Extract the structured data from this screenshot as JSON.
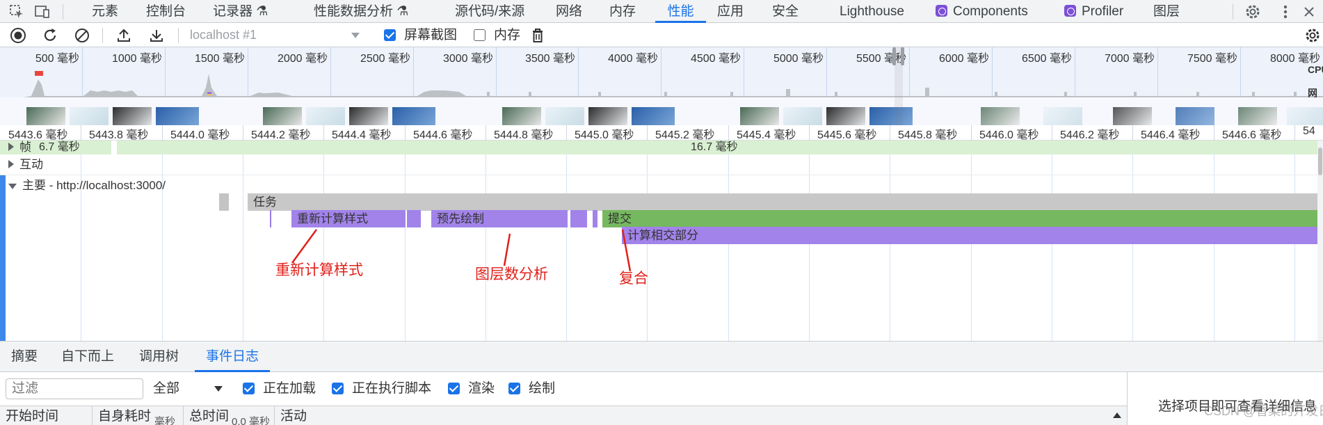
{
  "tabs": {
    "elements": "元素",
    "console": "控制台",
    "recorder": "记录器",
    "perf_insights": "性能数据分析",
    "sources": "源代码/来源",
    "network": "网络",
    "memory": "内存",
    "performance": "性能",
    "application": "应用",
    "security": "安全",
    "lighthouse": "Lighthouse",
    "components": "Components",
    "profiler": "Profiler",
    "layers": "图层"
  },
  "toolbar": {
    "target": "localhost #1",
    "screenshots_label": "屏幕截图",
    "screenshots_checked": true,
    "memory_label": "内存",
    "memory_checked": false
  },
  "overview": {
    "ticks": [
      "500 毫秒",
      "1000 毫秒",
      "1500 毫秒",
      "2000 毫秒",
      "2500 毫秒",
      "3000 毫秒",
      "3500 毫秒",
      "4000 毫秒",
      "4500 毫秒",
      "5000 毫秒",
      "5500 毫秒",
      "6000 毫秒",
      "6500 毫秒",
      "7000 毫秒",
      "7500 毫秒",
      "8000 毫秒"
    ],
    "cpu_label": "CPU",
    "net_label": "网络"
  },
  "ruler": {
    "labels": [
      "5443.6 毫秒",
      "5443.8 毫秒",
      "5444.0 毫秒",
      "5444.2 毫秒",
      "5444.4 毫秒",
      "5444.6 毫秒",
      "5444.8 毫秒",
      "5445.0 毫秒",
      "5445.2 毫秒",
      "5445.4 毫秒",
      "5445.6 毫秒",
      "5445.8 毫秒",
      "5446.0 毫秒",
      "5446.2 毫秒",
      "5446.4 毫秒",
      "5446.6 毫秒",
      "54"
    ]
  },
  "tracks": {
    "frames_label": "帧",
    "frame_a": "6.7 毫秒",
    "frame_b": "16.7 毫秒",
    "interactions_label": "互动",
    "main_label": "主要 - http://localhost:3000/",
    "task": "任务",
    "recalc": "重新计算样式",
    "prepaint": "预先绘制",
    "commit": "提交",
    "layerize": "计算相交部分"
  },
  "annotations": {
    "recalc": "重新计算样式",
    "layer": "图层数分析",
    "composite": "复合"
  },
  "bottom": {
    "tabs": {
      "summary": "摘要",
      "bottom_up": "自下而上",
      "call_tree": "调用树",
      "event_log": "事件日志"
    },
    "filter_placeholder": "过滤",
    "filter_select": "全部",
    "loading": "正在加载",
    "scripting": "正在执行脚本",
    "rendering": "渲染",
    "painting": "绘制",
    "col_start": "开始时间",
    "col_self": "自身耗时",
    "col_total": "总时间",
    "col_activity": "活动",
    "col_self_unit": "毫秒",
    "col_total_unit": "0.0 毫秒",
    "side_hint": "选择项目即可查看详细信息",
    "watermark": "CSDN @香菜的开发日记"
  }
}
